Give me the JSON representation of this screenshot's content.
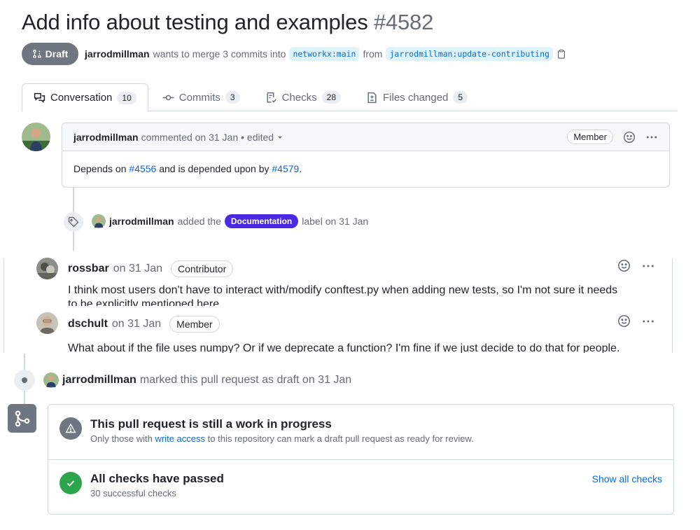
{
  "pr": {
    "title": "Add info about testing and examples",
    "number": "#4582",
    "state_label": "Draft",
    "author": "jarrodmillman",
    "merge_text": "wants to merge 3 commits into",
    "base_branch": "networkx:main",
    "from_text": "from",
    "head_branch": "jarrodmillman:update-contributing"
  },
  "tabs": [
    {
      "label": "Conversation",
      "count": "10",
      "icon": "comment-discussion-icon"
    },
    {
      "label": "Commits",
      "count": "3",
      "icon": "commit-icon"
    },
    {
      "label": "Checks",
      "count": "28",
      "icon": "checklist-icon"
    },
    {
      "label": "Files changed",
      "count": "5",
      "icon": "file-diff-icon"
    }
  ],
  "first_comment": {
    "author": "jarrodmillman",
    "action": "commented on 31 Jan",
    "edited": "• edited",
    "role": "Member",
    "body_prefix": "Depends on ",
    "link1": "#4556",
    "body_middle": " and is depended upon by ",
    "link2": "#4579",
    "body_suffix": "."
  },
  "label_event": {
    "author": "jarrodmillman",
    "text": "added the",
    "label": "Documentation",
    "suffix": "label on 31 Jan",
    "label_color": "#4b2ae3"
  },
  "comments": [
    {
      "author": "rossbar",
      "date": "on 31 Jan",
      "role": "Contributor",
      "line1": "I think most users don't have to interact with/modify conftest.py when adding new tests, so I'm not sure it needs",
      "line2": "to be explicitly mentioned here."
    },
    {
      "author": "dschult",
      "date": "on 31 Jan",
      "role": "Member",
      "line1": "What about if the file uses numpy? Or if we deprecate a function? I'm fine if we just decide to do that for people."
    }
  ],
  "draft_event": {
    "author": "jarrodmillman",
    "text": "marked this pull request as draft on 31 Jan"
  },
  "merge_box": {
    "wip_title": "This pull request is still a work in progress",
    "wip_sub_prefix": "Only those with",
    "wip_link": "write access",
    "wip_sub_suffix": "to this repository can mark a draft pull request as ready for review.",
    "checks_title": "All checks have passed",
    "checks_sub": "30 successful checks",
    "show_checks": "Show all checks",
    "success_color": "#2da44e",
    "neutral_color": "#6e7781"
  }
}
